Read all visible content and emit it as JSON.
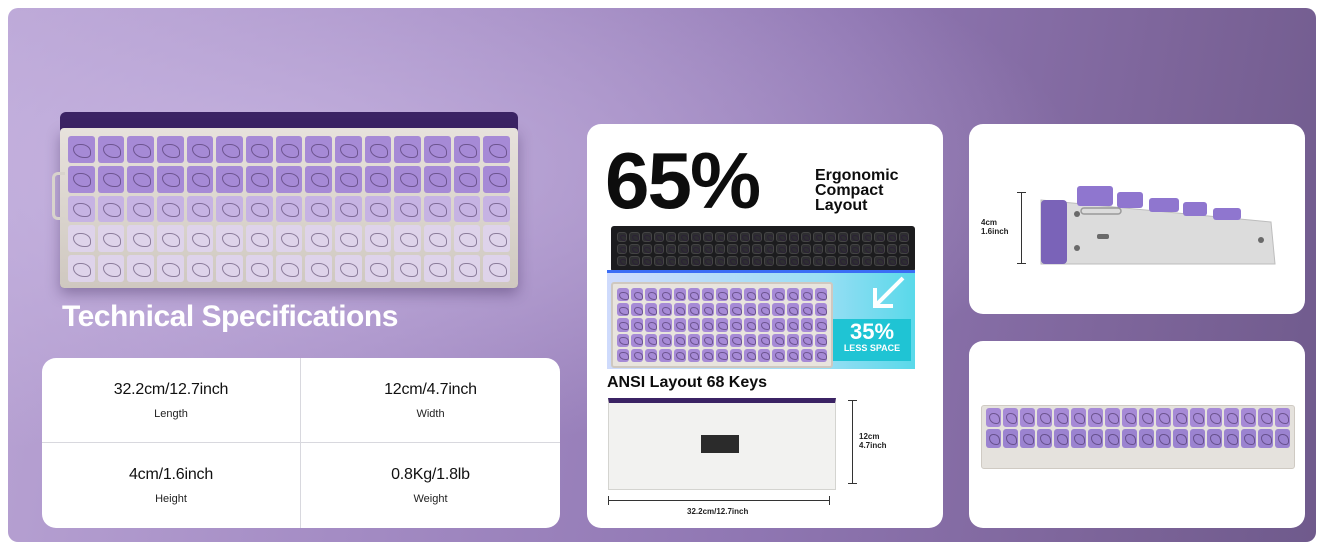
{
  "left": {
    "section_title": "Technical Specifications",
    "specs": [
      {
        "value": "32.2cm/12.7inch",
        "label": "Length"
      },
      {
        "value": "12cm/4.7inch",
        "label": "Width"
      },
      {
        "value": "4cm/1.6inch",
        "label": "Height"
      },
      {
        "value": "0.8Kg/1.8lb",
        "label": "Weight"
      }
    ]
  },
  "layout_card": {
    "percent": "65%",
    "caption": "Ergonomic Compact Layout",
    "less_space_pct": "35%",
    "less_space_text": "LESS SPACE",
    "layout_title": "ANSI Layout 68 Keys",
    "depth_dim": "12cm 4.7inch",
    "width_dim": "32.2cm/12.7inch"
  },
  "side_card": {
    "height_dim": "4cm 1.6inch"
  },
  "colors": {
    "banner_left": "#b9a4d4",
    "banner_right": "#6f5a8c",
    "keycap_purple": "#a68ad6",
    "keycap_light": "#ded3ea",
    "case": "#e7e2dc",
    "accent_blue": "#3b6df5",
    "accent_cyan": "#1fc4d4"
  }
}
